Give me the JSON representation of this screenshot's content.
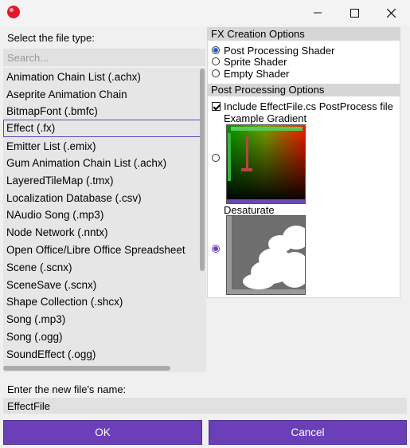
{
  "window": {
    "close_glyph": "✕",
    "minimize_glyph": "—"
  },
  "left": {
    "type_label": "Select the file type:",
    "search_placeholder": "Search...",
    "items": [
      "Animation Chain List (.achx)",
      "Aseprite Animation Chain",
      "BitmapFont (.bmfc)",
      "Effect (.fx)",
      "Emitter List (.emix)",
      "Gum Animation Chain List (.achx)",
      "LayeredTileMap (.tmx)",
      "Localization Database (.csv)",
      "NAudio Song (.mp3)",
      "Node Network (.nntx)",
      "Open Office/Libre Office Spreadsheet",
      "Scene (.scnx)",
      "SceneSave (.scnx)",
      "Shape Collection (.shcx)",
      "Song (.mp3)",
      "Song (.ogg)",
      "SoundEffect (.ogg)"
    ],
    "selected_index": 3,
    "name_label": "Enter the new file's name:",
    "name_value": "EffectFile"
  },
  "right": {
    "fx_header": "FX Creation Options",
    "fx_options": [
      "Post Processing Shader",
      "Sprite Shader",
      "Empty Shader"
    ],
    "fx_selected": 0,
    "pp_header": "Post Processing Options",
    "include_label": "Include EffectFile.cs PostProcess file",
    "include_checked": true,
    "example_gradient_label": "Example Gradient",
    "desaturate_label": "Desaturate",
    "preview_selected": "Desaturate"
  },
  "buttons": {
    "ok": "OK",
    "cancel": "Cancel"
  },
  "colors": {
    "accent": "#6a3fb8",
    "selection_border": "#5f4ab6",
    "app_icon": "#e5172a"
  }
}
